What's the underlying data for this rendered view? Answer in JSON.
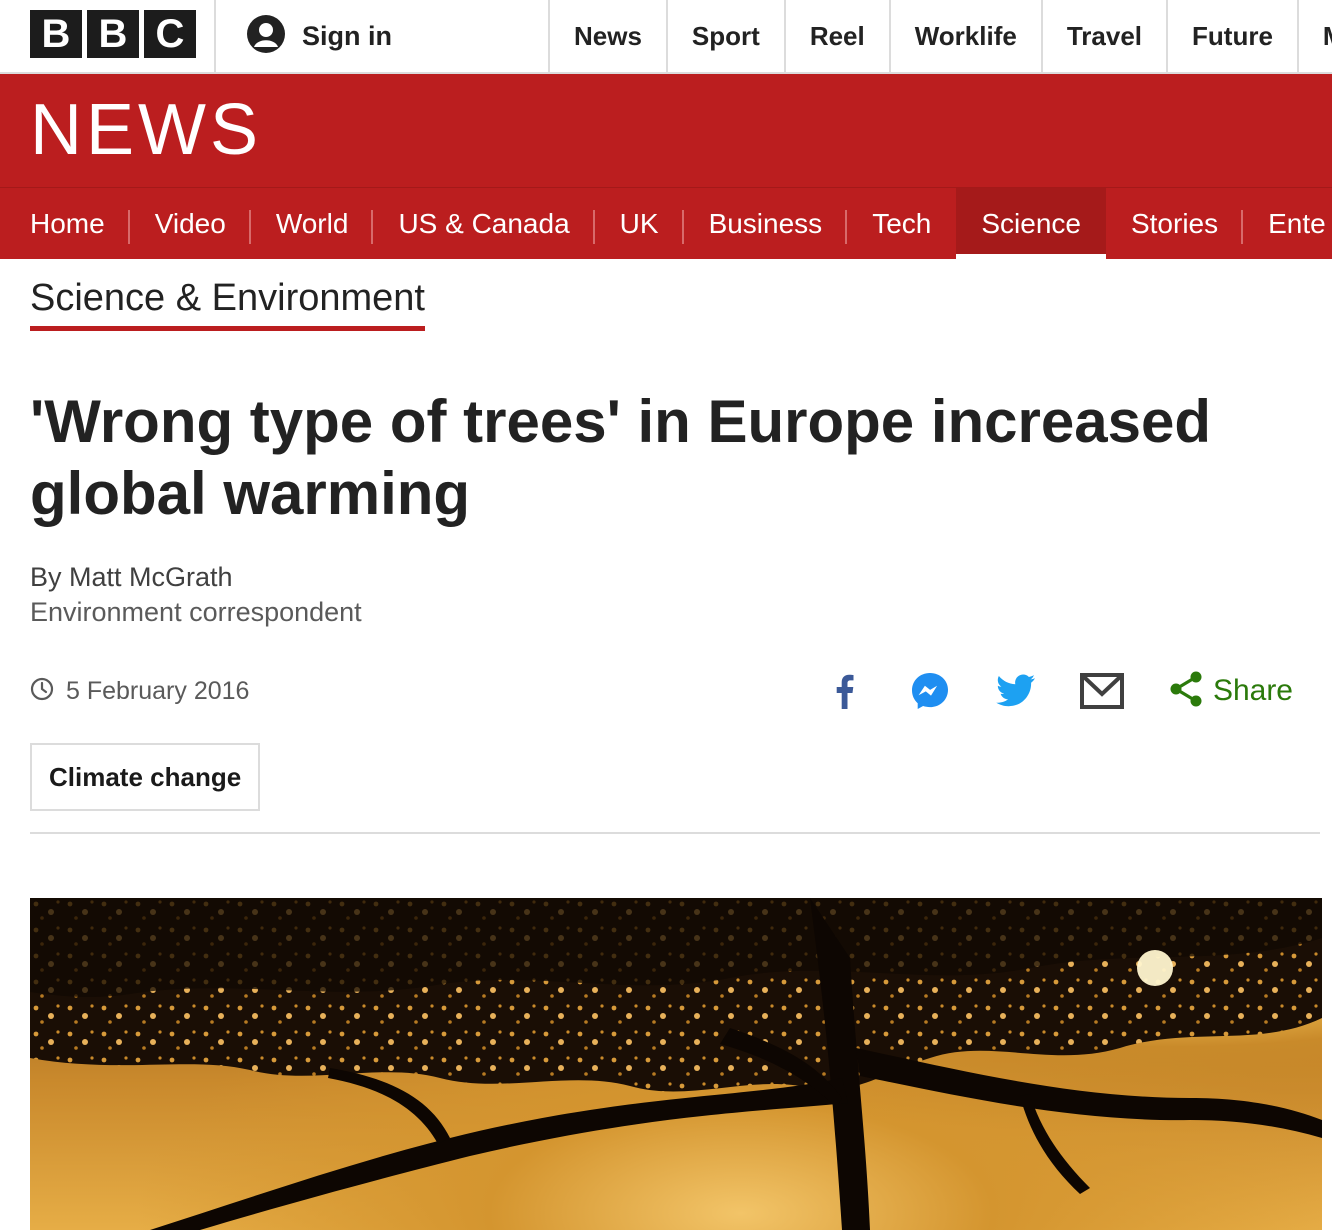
{
  "brand": {
    "bbc_letters": [
      "B",
      "B",
      "C"
    ],
    "news_wordmark": "NEWS",
    "accent_color": "#bb1e1f"
  },
  "account": {
    "sign_in_label": "Sign in",
    "icon": "user-icon"
  },
  "top_nav": [
    "News",
    "Sport",
    "Reel",
    "Worklife",
    "Travel",
    "Future",
    "M"
  ],
  "section_nav": {
    "items": [
      "Home",
      "Video",
      "World",
      "US & Canada",
      "UK",
      "Business",
      "Tech",
      "Science",
      "Stories",
      "Ente"
    ],
    "active": "Science"
  },
  "section_title": "Science & Environment",
  "article": {
    "headline": "'Wrong type of trees' in Europe increased global warming",
    "author": "By Matt McGrath",
    "author_role": "Environment correspondent",
    "date": "5 February 2016",
    "tag": "Climate change"
  },
  "share": {
    "icons": [
      "facebook-icon",
      "messenger-icon",
      "twitter-icon",
      "email-icon",
      "share-icon"
    ],
    "label": "Share",
    "label_color": "#2b7a0b"
  },
  "hero_image": {
    "subject": "tree-silhouette-sunset-image"
  }
}
